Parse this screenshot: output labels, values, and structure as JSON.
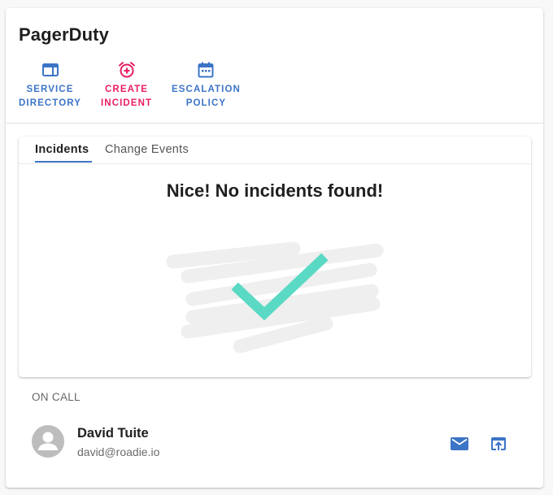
{
  "header": {
    "title": "PagerDuty"
  },
  "actions": [
    {
      "label": "SERVICE\nDIRECTORY",
      "icon": "web-icon",
      "color": "#3c74c6"
    },
    {
      "label": "CREATE\nINCIDENT",
      "icon": "alarm-add-icon",
      "color": "#e91e63"
    },
    {
      "label": "ESCALATION\nPOLICY",
      "icon": "calendar-icon",
      "color": "#3c74c6"
    }
  ],
  "tabs": [
    {
      "label": "Incidents",
      "active": true
    },
    {
      "label": "Change Events",
      "active": false
    }
  ],
  "incidents": {
    "empty_message": "Nice! No incidents found!"
  },
  "on_call": {
    "section_label": "ON CALL",
    "user": {
      "name": "David Tuite",
      "email": "david@roadie.io"
    },
    "actions": [
      "email-icon",
      "open-in-browser-icon"
    ]
  },
  "colors": {
    "accent": "#3c74c6",
    "alert": "#e91e63",
    "check": "#5ad9c5"
  }
}
